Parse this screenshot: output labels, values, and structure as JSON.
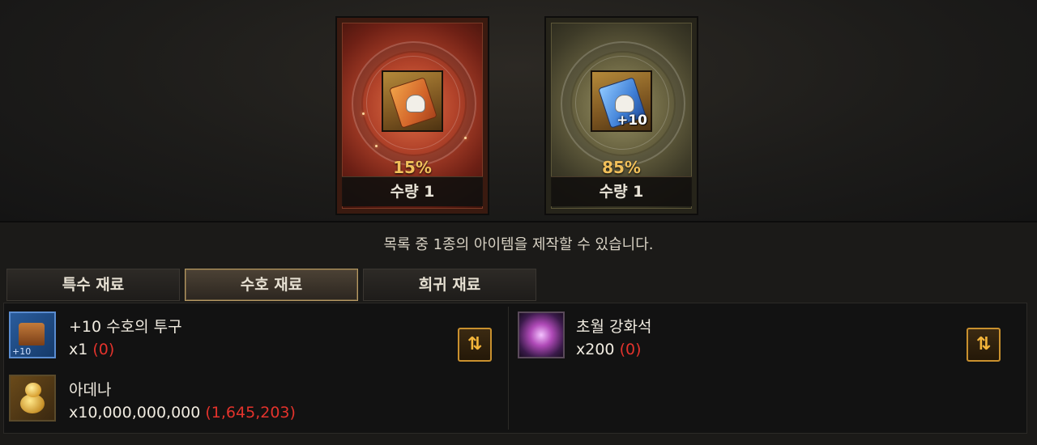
{
  "results": [
    {
      "percent": "15%",
      "quantity": "수량 1",
      "icon": "red-helm-scroll-icon"
    },
    {
      "percent": "85%",
      "quantity": "수량 1",
      "icon": "blue-helm-scroll-icon",
      "badge": "+10"
    }
  ],
  "message": "목록 중 1종의 아이템을 제작할 수 있습니다.",
  "tabs": [
    {
      "label": "특수 재료",
      "active": false
    },
    {
      "label": "수호 재료",
      "active": true
    },
    {
      "label": "희귀 재료",
      "active": false
    }
  ],
  "materials": {
    "left": [
      {
        "name": "+10 수호의 투구",
        "required": "x1",
        "owned": "(0)",
        "icon": "guardian-helm-icon",
        "badge": "+10"
      },
      {
        "name": "아데나",
        "required": "x10,000,000,000",
        "owned": "(1,645,203)",
        "icon": "adena-coins-icon"
      }
    ],
    "right": [
      {
        "name": "초월 강화석",
        "required": "x200",
        "owned": "(0)",
        "icon": "transcendence-stone-icon"
      }
    ]
  },
  "colors": {
    "owned_insufficient": "#e3332c",
    "percent": "#f1c05a",
    "active_tab_border": "#b79a64"
  }
}
